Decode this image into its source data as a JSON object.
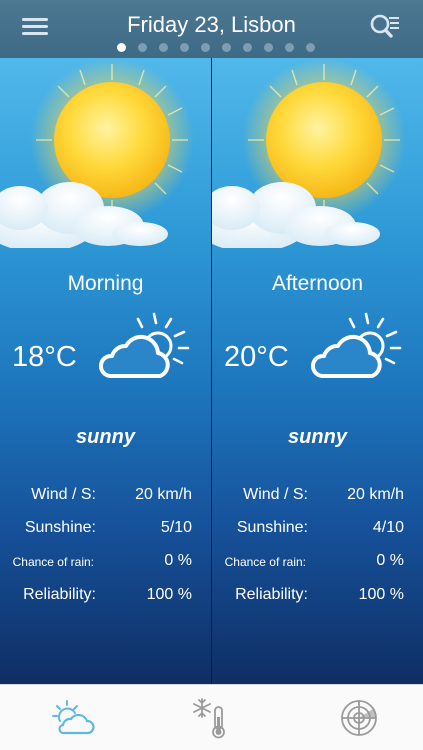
{
  "header": {
    "title": "Friday 23, Lisbon",
    "page_count": 10,
    "active_page": 0
  },
  "panels": [
    {
      "period": "Morning",
      "temperature": "18°C",
      "condition": "sunny",
      "stats": {
        "wind_label": "Wind / S:",
        "wind_value": "20 km/h",
        "sunshine_label": "Sunshine:",
        "sunshine_value": "5/10",
        "rain_label": "Chance of rain:",
        "rain_value": "0 %",
        "reliability_label": "Reliability:",
        "reliability_value": "100 %"
      }
    },
    {
      "period": "Afternoon",
      "temperature": "20°C",
      "condition": "sunny",
      "stats": {
        "wind_label": "Wind / S:",
        "wind_value": "20 km/h",
        "sunshine_label": "Sunshine:",
        "sunshine_value": "4/10",
        "rain_label": "Chance of rain:",
        "rain_value": "0 %",
        "reliability_label": "Reliability:",
        "reliability_value": "100 %"
      }
    }
  ],
  "tabbar": {
    "items": [
      {
        "icon": "partly-cloudy-icon",
        "active": true
      },
      {
        "icon": "snow-thermometer-icon",
        "active": false
      },
      {
        "icon": "radar-icon",
        "active": false
      }
    ]
  },
  "colors": {
    "header_bg": "#4a7590",
    "accent_active": "#5fb8e0",
    "inactive_icon": "#9a9a9a"
  }
}
